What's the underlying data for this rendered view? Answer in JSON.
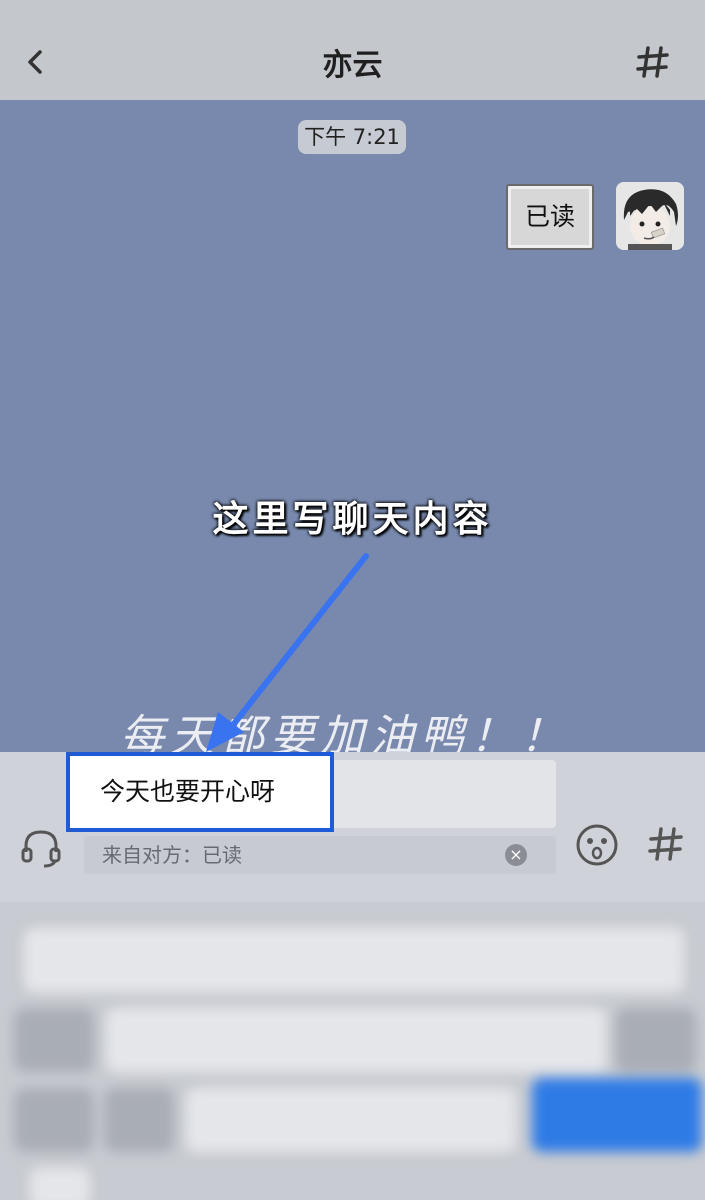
{
  "header": {
    "title": "亦云",
    "back_icon": "chevron-left-icon",
    "menu_icon": "hash-icon"
  },
  "chat": {
    "timestamp": "下午 7:21",
    "messages": [
      {
        "text": "已读",
        "from": "self"
      }
    ],
    "annotation": "这里写聊天内容",
    "wallpaper_text": "每天都要加油鸭！！"
  },
  "input": {
    "value": "今天也要开心呀",
    "quote": "来自对方：已读",
    "left_icon": "headset-icon",
    "right_icons": [
      "emoji-icon",
      "hash-icon"
    ]
  },
  "colors": {
    "chat_background": "#7889ad",
    "highlight_border": "#1f5bd6",
    "arrow": "#3a73f0"
  }
}
